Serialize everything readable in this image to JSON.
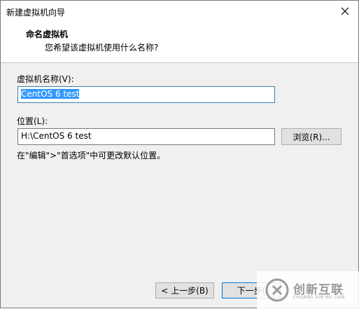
{
  "window": {
    "title": "新建虚拟机向导"
  },
  "header": {
    "heading": "命名虚拟机",
    "subheading": "您希望该虚拟机使用什么名称?"
  },
  "vm_name": {
    "label": "虚拟机名称(V):",
    "value": "CentOS 6 test"
  },
  "location": {
    "label": "位置(L):",
    "value": "H:\\CentOS 6 test",
    "browse_label": "浏览(R)..."
  },
  "hint": "在\"编辑\">\"首选项\"中可更改默认位置。",
  "footer": {
    "back_label": "< 上一步(B)",
    "next_label": "下一步("
  },
  "watermark": {
    "text": "创新互联",
    "subtext": "CHUANG XIN HU LIAN"
  },
  "colors": {
    "accent": "#0078d7",
    "selection": "#3399ff",
    "field_border_focused": "#3c7fb1"
  }
}
